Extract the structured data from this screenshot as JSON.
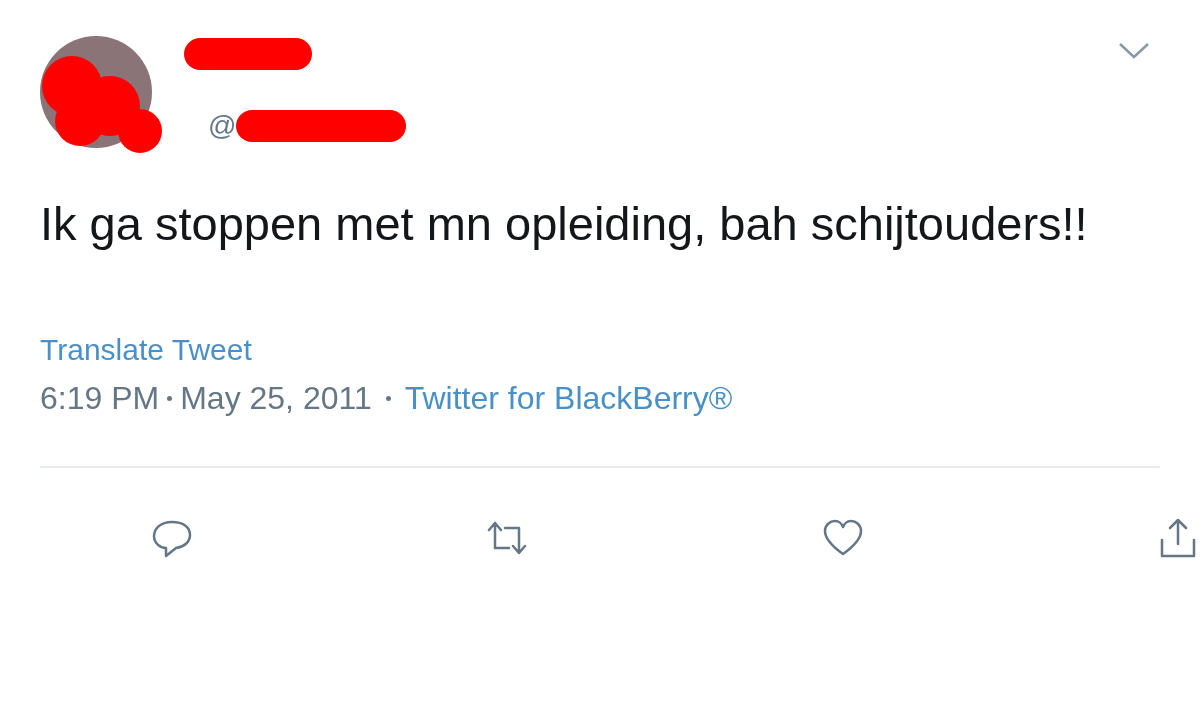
{
  "tweet": {
    "handle": "@",
    "text": "Ik ga stoppen met mn opleiding, bah schijtouders!!",
    "translate_label": "Translate Tweet",
    "time": "6:19 PM",
    "date": "May 25, 2011",
    "source": "Twitter for BlackBerry®"
  },
  "actions": [
    {
      "kind": "reply"
    },
    {
      "kind": "retweet"
    },
    {
      "kind": "like"
    },
    {
      "kind": "share"
    }
  ]
}
